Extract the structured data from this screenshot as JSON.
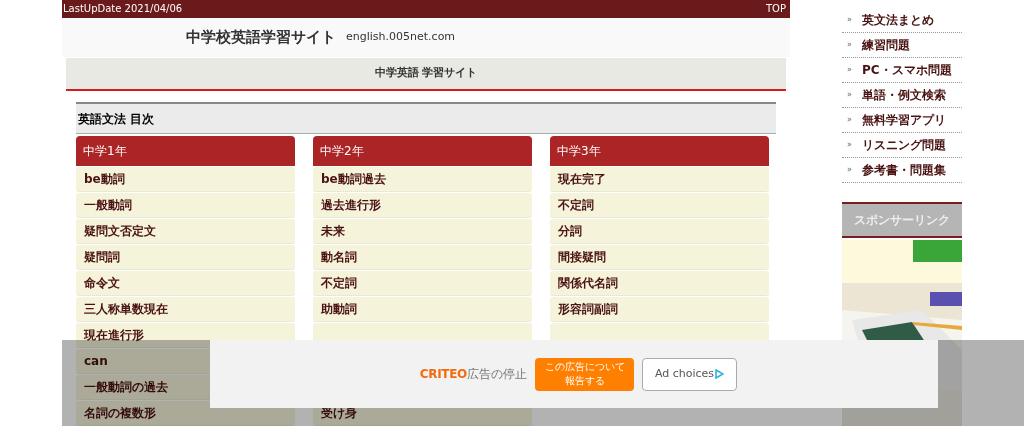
{
  "top_bar": {
    "update": "LastUpDate 2021/04/06",
    "top_link": "TOP"
  },
  "header": {
    "title": "中学校英語学習サイト",
    "domain": "english.005net.com"
  },
  "subheader": "中学英語 学習サイト",
  "toc": {
    "title": "英語文法 目次",
    "headings": [
      "中学1年",
      "中学2年",
      "中学3年"
    ],
    "rows": [
      [
        "be動詞",
        "be動詞過去",
        "現在完了"
      ],
      [
        "一般動詞",
        "過去進行形",
        "不定詞"
      ],
      [
        "疑問文否定文",
        "未来",
        "分詞"
      ],
      [
        "疑問詞",
        "動名詞",
        "間接疑問"
      ],
      [
        "命令文",
        "不定詞",
        "関係代名詞"
      ],
      [
        "三人称単数現在",
        "助動詞",
        "形容詞副詞"
      ],
      [
        "現在進行形",
        {
          "kind": "covered"
        },
        {
          "kind": "covered"
        }
      ],
      [
        "can"
      ],
      [
        "一般動詞の過去"
      ],
      [
        "名詞の複数形",
        "受け身"
      ]
    ]
  },
  "sidebar": {
    "bullet": "»",
    "links": [
      "英文法まとめ",
      "練習問題",
      "PC・スマホ問題",
      "単語・例文検索",
      "無料学習アプリ",
      "リスニング問題",
      "参考書・問題集"
    ],
    "sponsor_heading": "スポンサーリンク"
  },
  "ad_overlay": {
    "brand": "CRITEO",
    "stop": "広告の停止",
    "report_button": [
      "この広告について",
      "報告する"
    ],
    "ad_choices": "Ad choices"
  }
}
